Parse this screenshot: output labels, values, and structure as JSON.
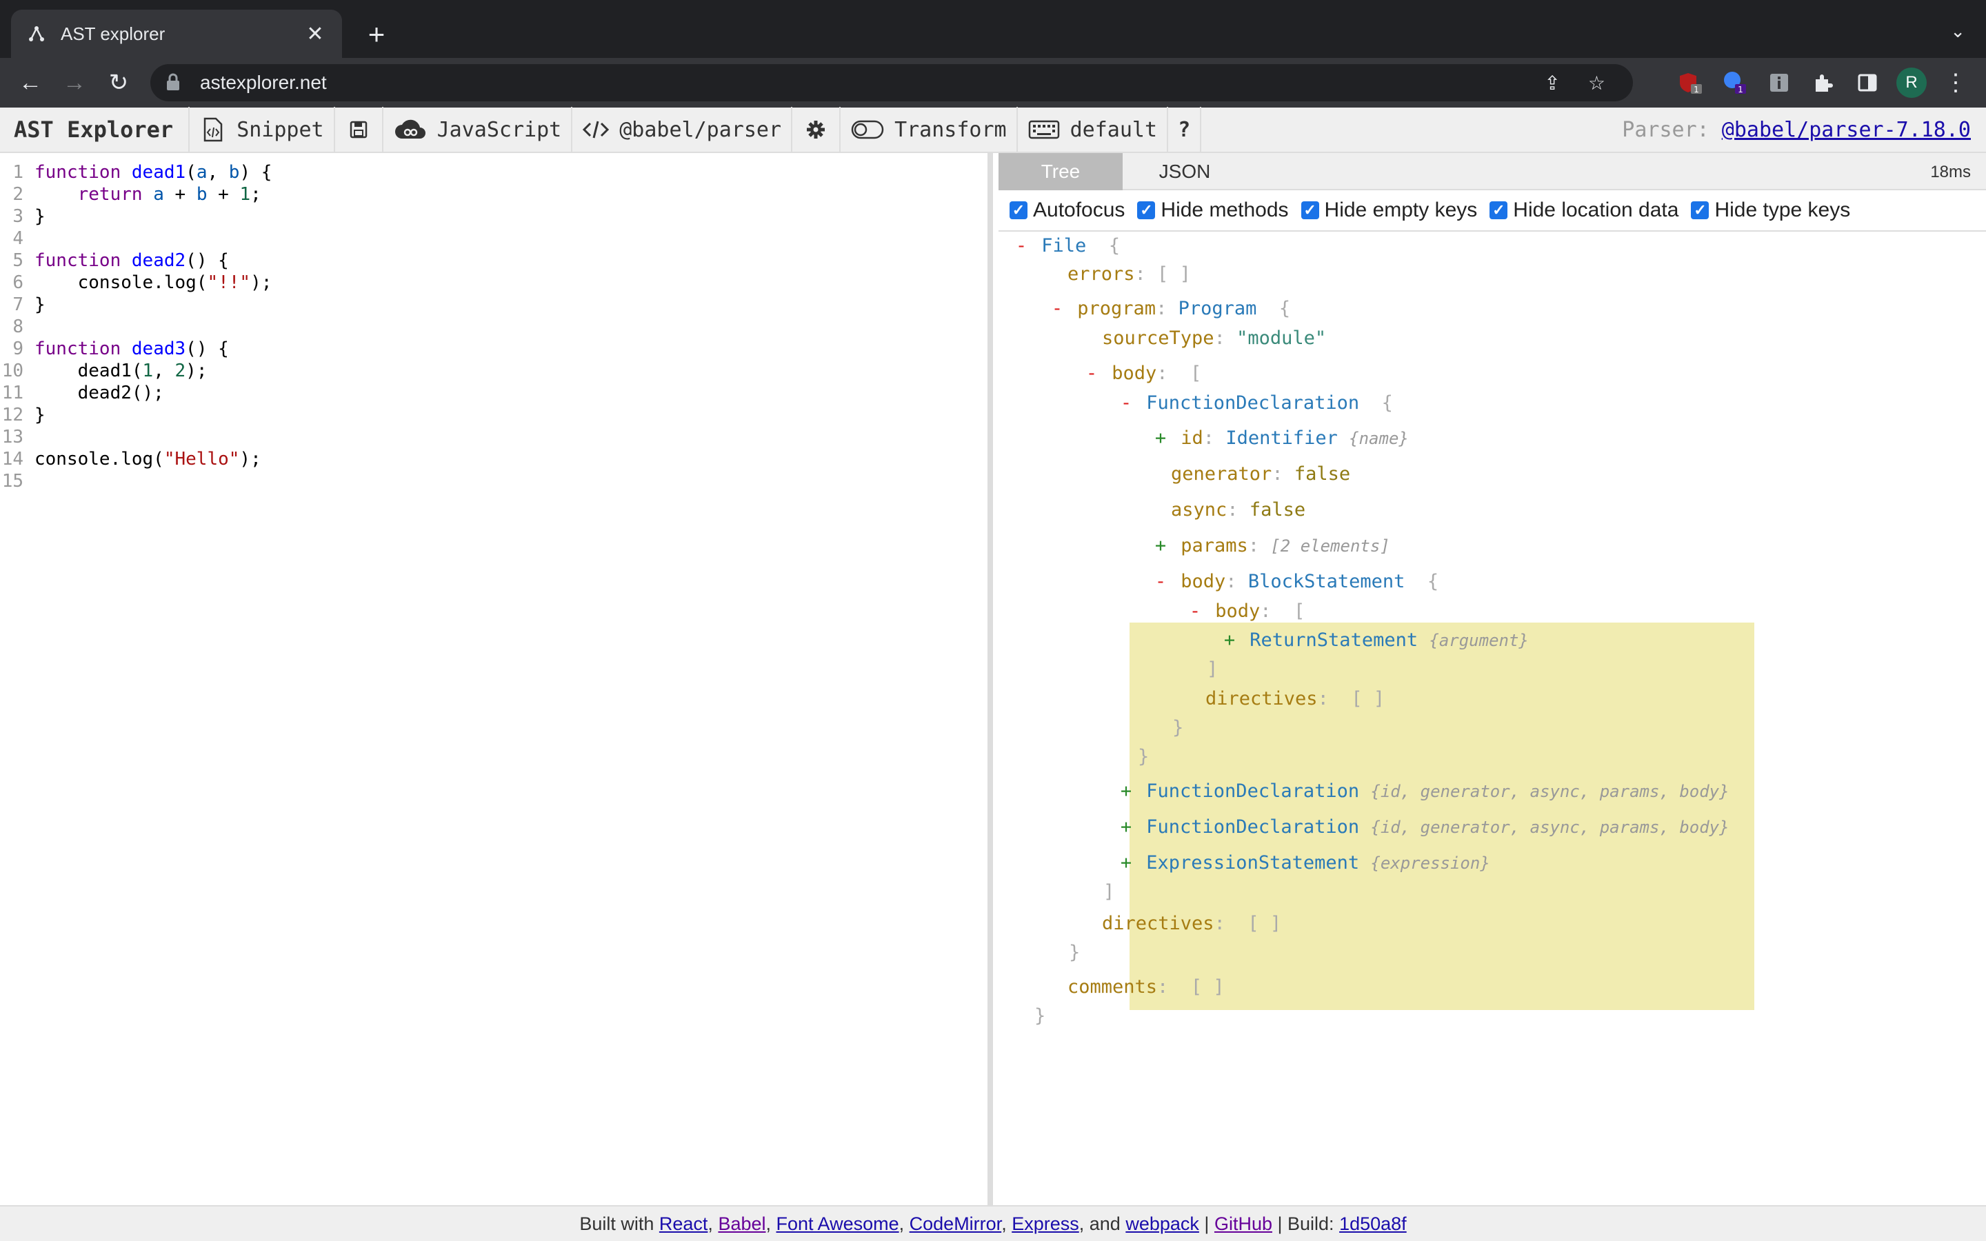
{
  "browser": {
    "tab_title": "AST explorer",
    "url": "astexplorer.net",
    "profile_initial": "R",
    "ext_badge_1": "1",
    "ext_badge_2": "1"
  },
  "toolbar": {
    "brand": "AST Explorer",
    "snippet": "Snippet",
    "language": "JavaScript",
    "parser": "@babel/parser",
    "transform": "Transform",
    "keymap": "default",
    "help": "?",
    "parser_label": "Parser:",
    "parser_version": "@babel/parser-7.18.0"
  },
  "editor": {
    "lines": [
      "function dead1(a, b) {",
      "    return a + b + 1;",
      "}",
      "",
      "function dead2() {",
      "    console.log(\"!!\");",
      "}",
      "",
      "function dead3() {",
      "    dead1(1, 2);",
      "    dead2();",
      "}",
      "",
      "console.log(\"Hello\");",
      ""
    ]
  },
  "output": {
    "tabs": [
      "Tree",
      "JSON"
    ],
    "active_tab": "Tree",
    "time": "18ms",
    "options": [
      "Autofocus",
      "Hide methods",
      "Hide empty keys",
      "Hide location data",
      "Hide type keys"
    ]
  },
  "tree": {
    "file": "File",
    "errors": "errors",
    "program_key": "program",
    "program_type": "Program",
    "sourceType_key": "sourceType",
    "sourceType_val": "\"module\"",
    "body_key": "body",
    "fd": "FunctionDeclaration",
    "id_key": "id",
    "identifier": "Identifier",
    "name_hint": "{name}",
    "generator_key": "generator",
    "async_key": "async",
    "false_val": "false",
    "params_key": "params",
    "params_hint": "[2 elements]",
    "block": "BlockStatement",
    "return_stmt": "ReturnStatement",
    "argument_hint": "{argument}",
    "directives_key": "directives",
    "fd_hint": "{id, generator, async, params, body}",
    "expr_stmt": "ExpressionStatement",
    "expression_hint": "{expression}",
    "comments_key": "comments"
  },
  "footer": {
    "built_with": "Built with",
    "react": "React",
    "babel": "Babel",
    "font_awesome": "Font Awesome",
    "codemirror": "CodeMirror",
    "express": "Express",
    "and": ", and",
    "webpack": "webpack",
    "github": "GitHub",
    "build_label": "| Build:",
    "build": "1d50a8f"
  }
}
